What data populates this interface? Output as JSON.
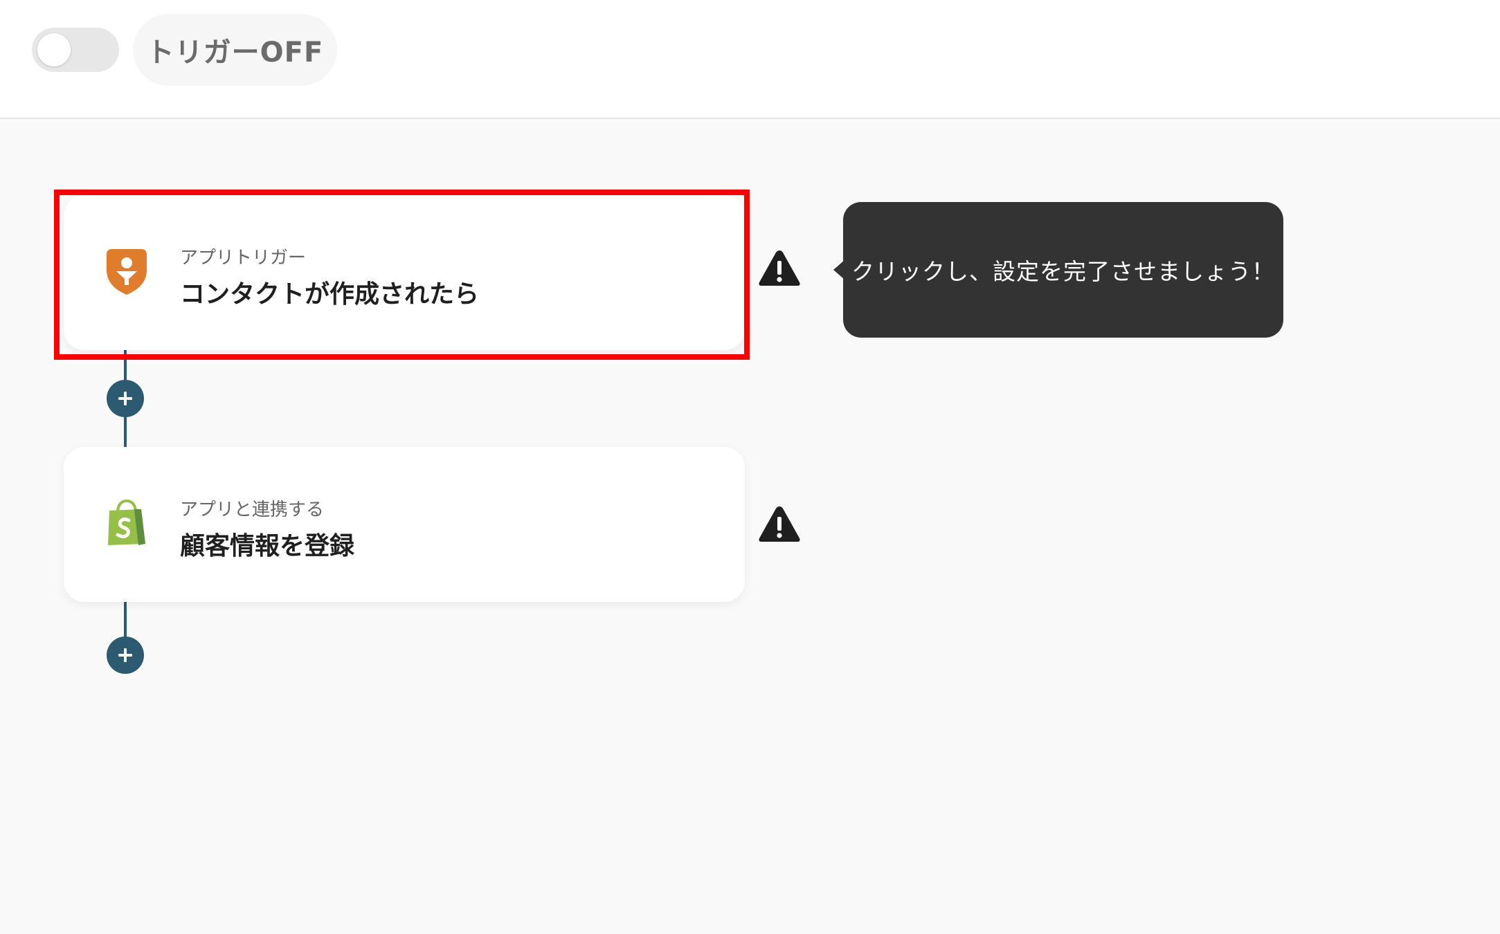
{
  "header": {
    "toggle_state": "off",
    "trigger_status_label": "トリガーOFF"
  },
  "flow": {
    "steps": [
      {
        "category": "アプリトリガー",
        "title": "コンタクトが作成されたら",
        "app_icon": "contact-app-icon",
        "icon_color": "#e07d2c",
        "warning": true,
        "highlighted": true
      },
      {
        "category": "アプリと連携する",
        "title": "顧客情報を登録",
        "app_icon": "shopify-icon",
        "icon_color": "#95bf47",
        "warning": true,
        "highlighted": false
      }
    ],
    "connector_color": "#2c5a70"
  },
  "tooltip": {
    "text": "クリックし、設定を完了させましょう！"
  },
  "colors": {
    "highlight": "#ff0000",
    "tooltip_bg": "#333333",
    "warning": "#1f1f1f"
  }
}
